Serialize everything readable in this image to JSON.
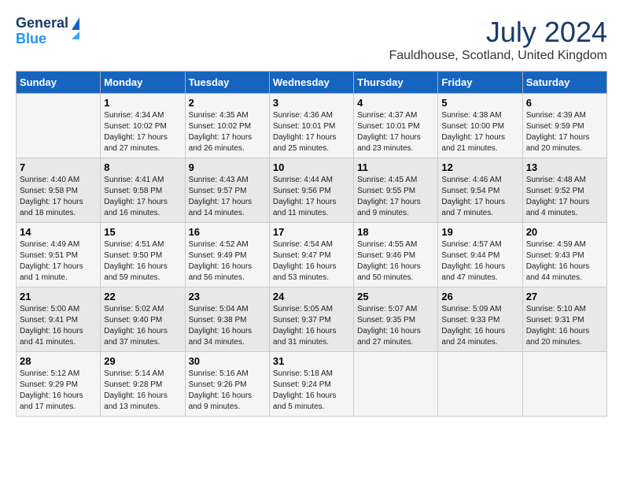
{
  "header": {
    "logo_line1": "General",
    "logo_line2": "Blue",
    "month_title": "July 2024",
    "location": "Fauldhouse, Scotland, United Kingdom"
  },
  "days_of_week": [
    "Sunday",
    "Monday",
    "Tuesday",
    "Wednesday",
    "Thursday",
    "Friday",
    "Saturday"
  ],
  "weeks": [
    [
      {
        "day": "",
        "sunrise": "",
        "sunset": "",
        "daylight": ""
      },
      {
        "day": "1",
        "sunrise": "Sunrise: 4:34 AM",
        "sunset": "Sunset: 10:02 PM",
        "daylight": "Daylight: 17 hours and 27 minutes."
      },
      {
        "day": "2",
        "sunrise": "Sunrise: 4:35 AM",
        "sunset": "Sunset: 10:02 PM",
        "daylight": "Daylight: 17 hours and 26 minutes."
      },
      {
        "day": "3",
        "sunrise": "Sunrise: 4:36 AM",
        "sunset": "Sunset: 10:01 PM",
        "daylight": "Daylight: 17 hours and 25 minutes."
      },
      {
        "day": "4",
        "sunrise": "Sunrise: 4:37 AM",
        "sunset": "Sunset: 10:01 PM",
        "daylight": "Daylight: 17 hours and 23 minutes."
      },
      {
        "day": "5",
        "sunrise": "Sunrise: 4:38 AM",
        "sunset": "Sunset: 10:00 PM",
        "daylight": "Daylight: 17 hours and 21 minutes."
      },
      {
        "day": "6",
        "sunrise": "Sunrise: 4:39 AM",
        "sunset": "Sunset: 9:59 PM",
        "daylight": "Daylight: 17 hours and 20 minutes."
      }
    ],
    [
      {
        "day": "7",
        "sunrise": "Sunrise: 4:40 AM",
        "sunset": "Sunset: 9:58 PM",
        "daylight": "Daylight: 17 hours and 18 minutes."
      },
      {
        "day": "8",
        "sunrise": "Sunrise: 4:41 AM",
        "sunset": "Sunset: 9:58 PM",
        "daylight": "Daylight: 17 hours and 16 minutes."
      },
      {
        "day": "9",
        "sunrise": "Sunrise: 4:43 AM",
        "sunset": "Sunset: 9:57 PM",
        "daylight": "Daylight: 17 hours and 14 minutes."
      },
      {
        "day": "10",
        "sunrise": "Sunrise: 4:44 AM",
        "sunset": "Sunset: 9:56 PM",
        "daylight": "Daylight: 17 hours and 11 minutes."
      },
      {
        "day": "11",
        "sunrise": "Sunrise: 4:45 AM",
        "sunset": "Sunset: 9:55 PM",
        "daylight": "Daylight: 17 hours and 9 minutes."
      },
      {
        "day": "12",
        "sunrise": "Sunrise: 4:46 AM",
        "sunset": "Sunset: 9:54 PM",
        "daylight": "Daylight: 17 hours and 7 minutes."
      },
      {
        "day": "13",
        "sunrise": "Sunrise: 4:48 AM",
        "sunset": "Sunset: 9:52 PM",
        "daylight": "Daylight: 17 hours and 4 minutes."
      }
    ],
    [
      {
        "day": "14",
        "sunrise": "Sunrise: 4:49 AM",
        "sunset": "Sunset: 9:51 PM",
        "daylight": "Daylight: 17 hours and 1 minute."
      },
      {
        "day": "15",
        "sunrise": "Sunrise: 4:51 AM",
        "sunset": "Sunset: 9:50 PM",
        "daylight": "Daylight: 16 hours and 59 minutes."
      },
      {
        "day": "16",
        "sunrise": "Sunrise: 4:52 AM",
        "sunset": "Sunset: 9:49 PM",
        "daylight": "Daylight: 16 hours and 56 minutes."
      },
      {
        "day": "17",
        "sunrise": "Sunrise: 4:54 AM",
        "sunset": "Sunset: 9:47 PM",
        "daylight": "Daylight: 16 hours and 53 minutes."
      },
      {
        "day": "18",
        "sunrise": "Sunrise: 4:55 AM",
        "sunset": "Sunset: 9:46 PM",
        "daylight": "Daylight: 16 hours and 50 minutes."
      },
      {
        "day": "19",
        "sunrise": "Sunrise: 4:57 AM",
        "sunset": "Sunset: 9:44 PM",
        "daylight": "Daylight: 16 hours and 47 minutes."
      },
      {
        "day": "20",
        "sunrise": "Sunrise: 4:59 AM",
        "sunset": "Sunset: 9:43 PM",
        "daylight": "Daylight: 16 hours and 44 minutes."
      }
    ],
    [
      {
        "day": "21",
        "sunrise": "Sunrise: 5:00 AM",
        "sunset": "Sunset: 9:41 PM",
        "daylight": "Daylight: 16 hours and 41 minutes."
      },
      {
        "day": "22",
        "sunrise": "Sunrise: 5:02 AM",
        "sunset": "Sunset: 9:40 PM",
        "daylight": "Daylight: 16 hours and 37 minutes."
      },
      {
        "day": "23",
        "sunrise": "Sunrise: 5:04 AM",
        "sunset": "Sunset: 9:38 PM",
        "daylight": "Daylight: 16 hours and 34 minutes."
      },
      {
        "day": "24",
        "sunrise": "Sunrise: 5:05 AM",
        "sunset": "Sunset: 9:37 PM",
        "daylight": "Daylight: 16 hours and 31 minutes."
      },
      {
        "day": "25",
        "sunrise": "Sunrise: 5:07 AM",
        "sunset": "Sunset: 9:35 PM",
        "daylight": "Daylight: 16 hours and 27 minutes."
      },
      {
        "day": "26",
        "sunrise": "Sunrise: 5:09 AM",
        "sunset": "Sunset: 9:33 PM",
        "daylight": "Daylight: 16 hours and 24 minutes."
      },
      {
        "day": "27",
        "sunrise": "Sunrise: 5:10 AM",
        "sunset": "Sunset: 9:31 PM",
        "daylight": "Daylight: 16 hours and 20 minutes."
      }
    ],
    [
      {
        "day": "28",
        "sunrise": "Sunrise: 5:12 AM",
        "sunset": "Sunset: 9:29 PM",
        "daylight": "Daylight: 16 hours and 17 minutes."
      },
      {
        "day": "29",
        "sunrise": "Sunrise: 5:14 AM",
        "sunset": "Sunset: 9:28 PM",
        "daylight": "Daylight: 16 hours and 13 minutes."
      },
      {
        "day": "30",
        "sunrise": "Sunrise: 5:16 AM",
        "sunset": "Sunset: 9:26 PM",
        "daylight": "Daylight: 16 hours and 9 minutes."
      },
      {
        "day": "31",
        "sunrise": "Sunrise: 5:18 AM",
        "sunset": "Sunset: 9:24 PM",
        "daylight": "Daylight: 16 hours and 5 minutes."
      },
      {
        "day": "",
        "sunrise": "",
        "sunset": "",
        "daylight": ""
      },
      {
        "day": "",
        "sunrise": "",
        "sunset": "",
        "daylight": ""
      },
      {
        "day": "",
        "sunrise": "",
        "sunset": "",
        "daylight": ""
      }
    ]
  ]
}
